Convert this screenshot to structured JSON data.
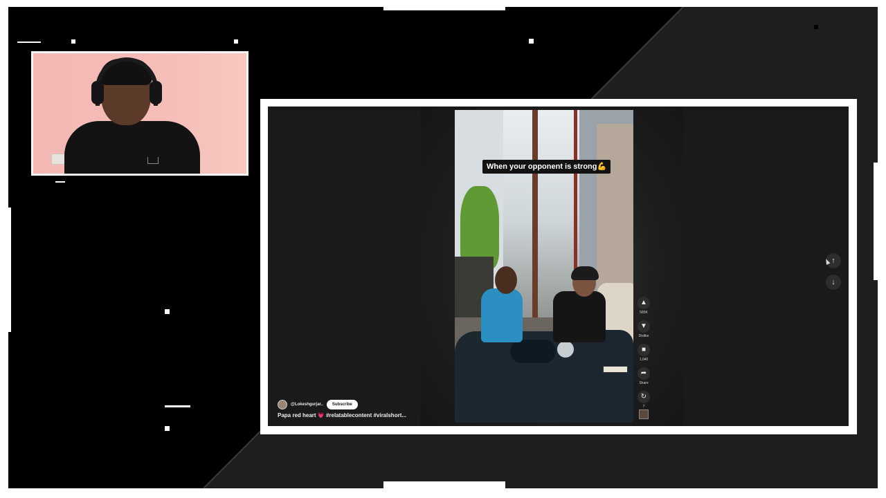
{
  "webcam": {
    "label": "Streamer webcam feed"
  },
  "video": {
    "caption": "When your opponent is strong💪",
    "channel_name": "@Lokeshgurjar..",
    "subscribe_label": "Subscribe",
    "description": "Papa red heart 💗 #relatablecontent #viralshort..."
  },
  "actions": {
    "like": {
      "icon": "thumbs-up-icon",
      "count": "585K"
    },
    "dislike": {
      "icon": "thumbs-down-icon",
      "label": "Dislike"
    },
    "comments": {
      "icon": "comment-icon",
      "count": "1,040"
    },
    "share": {
      "icon": "share-icon",
      "label": "Share"
    },
    "remix": {
      "icon": "remix-icon",
      "count": "7"
    }
  },
  "navigation": {
    "previous": {
      "icon": "arrow-up-icon"
    },
    "next": {
      "icon": "arrow-down-icon"
    }
  },
  "colors": {
    "frame": "#000000",
    "overlay_white": "#ffffff",
    "viewer_bg": "#1a1a1a",
    "subscribe_bg": "#ffffff"
  }
}
